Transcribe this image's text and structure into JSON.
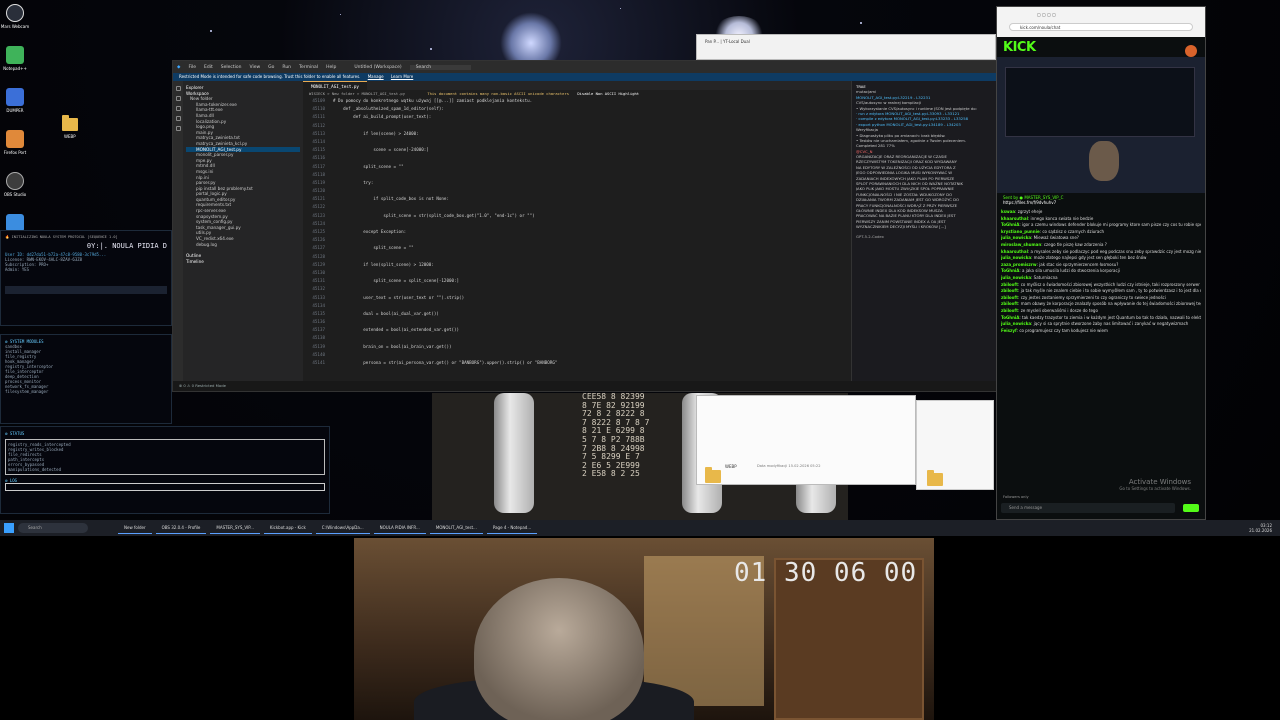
{
  "desktop": {
    "icons": [
      {
        "label": "Mars Webcam",
        "color": "#2a2f3a"
      },
      {
        "label": "Notepad++",
        "color": "#3fb35a"
      },
      {
        "label": "DUMPER",
        "color": "#3b6fd8"
      },
      {
        "label": "Firefox Port",
        "color": "#e0893a"
      },
      {
        "label": "OBS Studio",
        "color": "#3d3d3d"
      },
      {
        "label": "Py-Com",
        "color": "#3b8de0"
      }
    ],
    "folder_label": "WEBP"
  },
  "terminal_top": {
    "title": "0Y:|.  NOULA PIDIA D",
    "banner": "🔥 INITIALIZING NOULA SYSTEM PROTOCOL [SEQUENCE 1.0]",
    "lines": [
      "User ID: dd27da51-b72a-47c8-9580-3c79d5...",
      "License: RWN-EKOV-4ALC-8ZAV-63Z8",
      "Subscription: PRO+",
      "Admin: YES"
    ]
  },
  "terminal_mid": {
    "header": "⚙ SYSTEM MODULES",
    "lines": [
      "sandbox",
      "install_manager",
      "file_registry",
      "hook_manager",
      "registry_interceptor",
      "file_interceptor",
      "deep_detection",
      "process_monitor",
      "network_fs_manager",
      "filesystem_manager"
    ]
  },
  "terminal_bot": {
    "header": "⚙ STATUS",
    "lines": [
      "registry_reads_intercepted",
      "registry_writes_blocked",
      "file_redirects",
      "path_intercepts",
      "errors_bypassed",
      "manipulations_detected"
    ],
    "footer": "⚙ LOG"
  },
  "vscode": {
    "menu": [
      "File",
      "Edit",
      "Selection",
      "View",
      "Go",
      "Run",
      "Terminal",
      "Help"
    ],
    "workspace_title": "Untitled (Workspace)",
    "search_placeholder": "Search",
    "restricted_banner": "Restricted Mode is intended for safe code browsing. Trust this folder to enable all features.",
    "restricted_manage": "Manage",
    "restricted_learn": "Learn More",
    "explorer_title": "Explorer",
    "workspace_label": "Workspace",
    "files": [
      "New folder",
      "llama-tokenizer.exe",
      "llama-ttt.exe",
      "llama.dll",
      "localization.py",
      "logo.png",
      "main.py",
      "matryca_zwinieta.txt",
      "matryca_zwinieta_kcl.py",
      "MONOLIT_AGI_test.py",
      "monolit_parser.py",
      "mpe.py",
      "mtmd.dll",
      "msgs.ini",
      "nlp.ini",
      "parser.py",
      "pip install bez problemy.txt",
      "portal_logic.py",
      "quantum_editor.py",
      "requirements.txt",
      "rpc-server.exe",
      "snapsystem.py",
      "system_config.py",
      "task_manager_gui.py",
      "utils.py",
      "VC_redist.x64.exe",
      "debug.log"
    ],
    "selected_file": "MONOLIT_AGI_test.py",
    "outline_label": "Outline",
    "timeline_label": "Timeline",
    "tab": "MONOLIT_AGI_test.py",
    "breadcrumb": "WISIECK > New folder > MONOLIT_AGI_test.py",
    "unicode_warning": "This document contains many non-basic ASCII unicode characters",
    "unicode_action": "Disable Non ASCII Highlight",
    "code": [
      {
        "n": "45109",
        "t": "# Do pomocy do konkretnego wątku używaj [[@...]] zamiast podklejania kontekstu."
      },
      {
        "n": "45110",
        "t": "    def _absolutheized_spam_1d_editor(self):"
      },
      {
        "n": "45111",
        "t": "        def ai_build_prompt(user_text):"
      },
      {
        "n": "45112",
        "t": ""
      },
      {
        "n": "45113",
        "t": "            if len(scene) > 24000:"
      },
      {
        "n": "45114",
        "t": ""
      },
      {
        "n": "45115",
        "t": "                scene = scene[-24000:]"
      },
      {
        "n": "45116",
        "t": ""
      },
      {
        "n": "45117",
        "t": "            split_scene = \"\""
      },
      {
        "n": "45118",
        "t": ""
      },
      {
        "n": "45119",
        "t": "            try:"
      },
      {
        "n": "45120",
        "t": ""
      },
      {
        "n": "45121",
        "t": "                if split_code_box is not None:"
      },
      {
        "n": "45122",
        "t": ""
      },
      {
        "n": "45123",
        "t": "                    split_scene = str(split_code_box.get(\"1.0\", \"end-1c\") or \"\")"
      },
      {
        "n": "45124",
        "t": ""
      },
      {
        "n": "45125",
        "t": "            except Exception:"
      },
      {
        "n": "45126",
        "t": ""
      },
      {
        "n": "45127",
        "t": "                split_scene = \"\""
      },
      {
        "n": "45128",
        "t": ""
      },
      {
        "n": "45129",
        "t": "            if len(split_scene) > 12000:"
      },
      {
        "n": "45130",
        "t": ""
      },
      {
        "n": "45131",
        "t": "                split_scene = split_scene[-12000:]"
      },
      {
        "n": "45132",
        "t": ""
      },
      {
        "n": "45133",
        "t": "            user_text = str(user_text or \"\").strip()"
      },
      {
        "n": "45134",
        "t": ""
      },
      {
        "n": "45135",
        "t": "            dual = bool(ai_dual_var.get())"
      },
      {
        "n": "45136",
        "t": ""
      },
      {
        "n": "45137",
        "t": "            extended = bool(ai_extended_var.get())"
      },
      {
        "n": "45138",
        "t": ""
      },
      {
        "n": "45139",
        "t": "            brain_on = bool(ai_brain_var.get())"
      },
      {
        "n": "45140",
        "t": ""
      },
      {
        "n": "45141",
        "t": "            persona = str(ai_persona_var.get() or \"BANBORG\").upper().strip() or \"BANBORG\""
      }
    ],
    "chat": {
      "title": "TRAE",
      "lines": [
        {
          "c": "",
          "t": "mutacjami"
        },
        {
          "c": "cy",
          "t": "MONOLIT_AGI_test.py:L32219 - L32231"
        },
        {
          "c": "",
          "t": "CVS/autosync w realnej kompilacji"
        },
        {
          "c": "",
          "t": "• Wykorzystanie CVS/autosync i runtime JSON jest podpięte do:"
        },
        {
          "c": "cy",
          "t": "   · run z edytora MONOLIT_AGI_test.py:L33093 - L33121"
        },
        {
          "c": "cy",
          "t": "   · compile z edytora MONOLIT_AGI_test.py:L33233 - L33258"
        },
        {
          "c": "cy",
          "t": "   · export python MONOLIT_AGI_test.py:L34189 - L34203"
        },
        {
          "c": "",
          "t": "Weryfikacja"
        },
        {
          "c": "",
          "t": "• Diagnostyka pliku po zmianach: brak błędów."
        },
        {
          "c": "",
          "t": "• Testów nie uruchamiałem, zgodnie z Twoim poleceniem."
        },
        {
          "c": "",
          "t": "Completed   281   77%"
        },
        {
          "c": "rd",
          "t": "@CVC_N"
        },
        {
          "c": "",
          "t": "ORGANIZACJE ORAZ REORGANIZACJE W CZASIE"
        },
        {
          "c": "",
          "t": "RZECZYWISTYM TOKENIZACJI ORAZ KOD WYDAWANY"
        },
        {
          "c": "",
          "t": "NA EDYTORY W ZALEŻNOŚCI OD UŻYCIA EDYTORA Z"
        },
        {
          "c": "",
          "t": "JEGO ODPOWIEDNIA LOGIKA MUSI WYKONYWAĆ W"
        },
        {
          "c": "",
          "t": "ZADANIACH INDEXOWYCH JAKO PLAN PO PIERWSZE"
        },
        {
          "c": "",
          "t": "SPLOT PORAWNANIOCH DLA NICH OD WAŻNE NOTATNIK"
        },
        {
          "c": "",
          "t": "JAKO PLIK JAKO MOSTU ZWIĄZKIE SPOŁ POPRAWNIE"
        },
        {
          "c": "",
          "t": "FUNKCJONALNOŚCI I NIE ZOSTAŁ WDUKOZONY DO"
        },
        {
          "c": "",
          "t": "DZIAŁANIA TWORM ZADANIAM JEST GO WDROŻYĆ DO"
        },
        {
          "c": "",
          "t": "PRACY FUNKCJONALNOŚCI WDRĄŻ Z PRZY PIERWSZE"
        },
        {
          "c": "",
          "t": "GŁÓWNIE INDEX DLA KOD INDEKSOW MUSZA"
        },
        {
          "c": "",
          "t": "PRACOWAĆ NA BAZIE PLANU KTÓRY DLA INDEX JEST"
        },
        {
          "c": "",
          "t": "PIERWSZY ZANIM POWSTANIE INDEX A OA JEST"
        },
        {
          "c": "",
          "t": "WYZNACZNIKIEM DECYZJI MYŚLI I KROKÓW [...]"
        }
      ],
      "footer": "GPT-5.2-Codex"
    },
    "status": "⊗ 0 ⚠ 0   Restricted Mode"
  },
  "browser_back": {
    "tab": "Pan P... | YT-Local Dual",
    "url": "file:///C:/..."
  },
  "kick": {
    "url": "kick.com/noula/chat",
    "logo": "KICK",
    "pinned_by": "Sent by ● MASTER_SYS_VIP_C",
    "pinned_link": "https://files.fm/f/9dvhuhv7",
    "messages": [
      {
        "u": "kswaa",
        "t": ": zgrzyt eheje"
      },
      {
        "u": "khaarsuthal",
        "t": ": innego konca swiata nie bedzie"
      },
      {
        "u": "ToGhniA",
        "t": ": igor a czemu windows defender blokuje mi programy ktore sam pisze czy cos tu robie specjalnie"
      },
      {
        "u": "krystiano_punnie",
        "t": ": co sądzisz o czarnych dziurach"
      },
      {
        "u": "julia_nowicka",
        "t": ": Mieważ światowa sne?"
      },
      {
        "u": "miroslaw_shuman",
        "t": ": czego tle piszę kaw zdarzenia ?"
      },
      {
        "u": "khaarsuthal",
        "t": ": a mysales zeby sie podlaczyc pod eeg podczas snu zeby sprawdzic czy jest mozg nie wysyla oblych obrazow?"
      },
      {
        "u": "julia_nowicka",
        "t": ": może zlatego najlepsi gdy jest sen głęboki ten bez śnów"
      },
      {
        "u": "zaza_promiszrw",
        "t": ": jak stac sie sprzymierzencem łosmosu?"
      },
      {
        "u": "ToGhniA",
        "t": ": a jaka sila umusila ludzi do stworzenia korporacji"
      },
      {
        "u": "julia_nowicka",
        "t": ": Saturniacna"
      },
      {
        "u": "zbilooft",
        "t": ": co myślisz o świadomości zbiorowej wszystkich ludzi czy istnieje, taki rozproszony serwer w naszych głowach"
      },
      {
        "u": "zbilooft",
        "t": ": ja tak myśle nie znalem ciebie i to sobie wymyślłem sam , ty to potwierdzasz i to jest dla mnie ważne"
      },
      {
        "u": "zbilooft",
        "t": ": czy jestes zostaniemy sprzymierzeni to czy ograniczy to swiece jedności"
      },
      {
        "u": "zbilooft",
        "t": ": mam obawy że korporacje znalazły sposób na wpływanie do tej świadomości zbiorowej tego serwera rozproszonego i szpieg"
      },
      {
        "u": "zbilooft",
        "t": ": ze mysleli oberwaliśmi i dosze do tego"
      },
      {
        "u": "ToGhniA",
        "t": ": tak kaedzy trazystor to ziemia i w każdym jest Quantum bo tak to działa, nazwali to elektronami, to tylko nazwa"
      },
      {
        "u": "julia_nowicka",
        "t": ": jący si sa sprytnie stworzone żaby nas limitować i zanykać w negatywizmach"
      },
      {
        "u": "Feiszyf",
        "t": ": co programujesz czy tam kodujesz nie wiem"
      }
    ],
    "followers_only": "Followers only",
    "input_placeholder": "Send a message",
    "activate_title": "Activate Windows",
    "activate_sub": "Go to Settings to activate Windows."
  },
  "file_dialog": {
    "folder": "WEBP",
    "meta": "Data modyfikacji 15.02.2026 05:22"
  },
  "taskbar": {
    "search": "Search",
    "tasks": [
      "New folder",
      "OBS 32.0.4 - Profile",
      "MASTER_SYS_VIP...",
      "Kickbot.app - Kick",
      "C:\\Windows\\AppDa...",
      "NOULA PIDIA INFR...",
      "MONOLIT_AGI_test...",
      "Page 4 - Notepad..."
    ],
    "time": "03:12",
    "date": "21.02.2026"
  },
  "webcam": {
    "timer": "01 30 06 00"
  }
}
